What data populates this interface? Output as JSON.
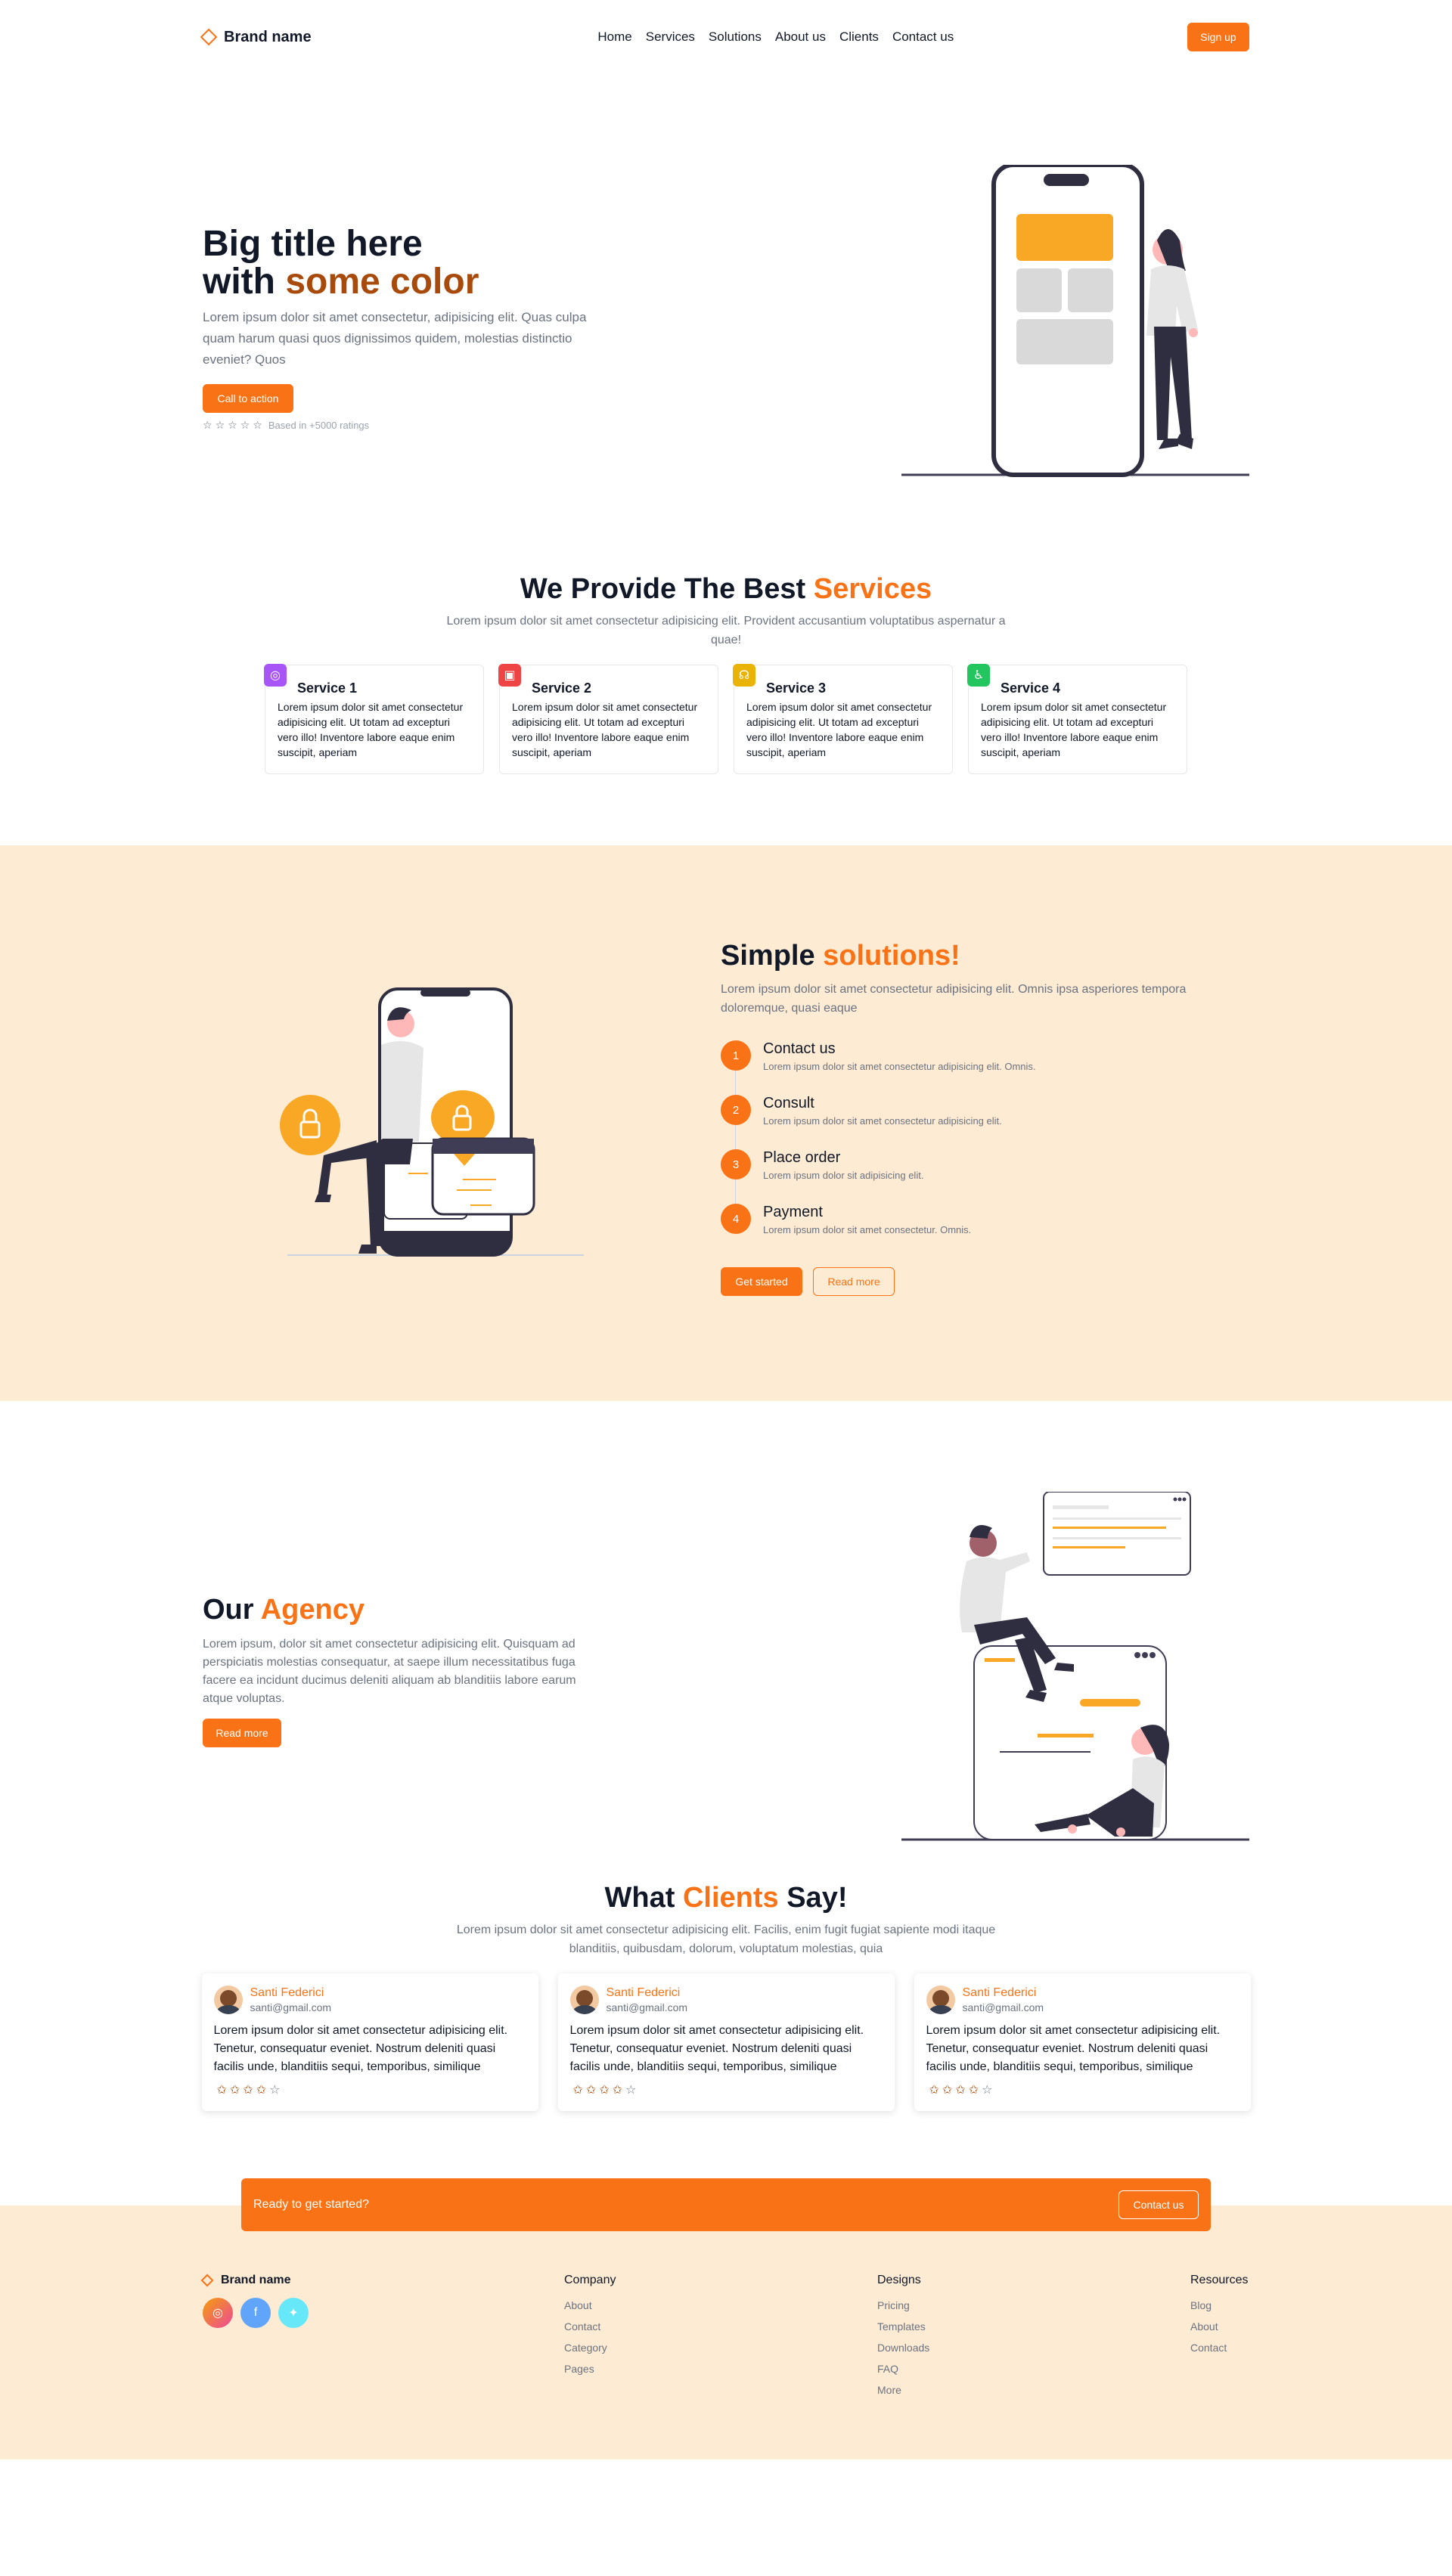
{
  "nav": {
    "brand": "Brand name",
    "links": [
      "Home",
      "Services",
      "Solutions",
      "About us",
      "Clients",
      "Contact us"
    ],
    "signup": "Sign up"
  },
  "hero": {
    "title_line1": "Big title here",
    "title_line2_prefix": "with ",
    "title_line2_accent": "some color",
    "text": "Lorem ipsum dolor sit amet consectetur, adipisicing elit. Quas culpa quam harum quasi quos dignissimos quidem, molestias distinctio eveniet? Quos",
    "cta": "Call to action",
    "rating_text": "Based in +5000 ratings"
  },
  "services": {
    "title_prefix": "We Provide The Best ",
    "title_accent": "Services",
    "subtitle": "Lorem ipsum dolor sit amet consectetur adipisicing elit. Provident accusantium voluptatibus aspernatur a quae!",
    "items": [
      {
        "title": "Service 1",
        "text": "Lorem ipsum dolor sit amet consectetur adipisicing elit. Ut totam ad excepturi vero illo! Inventore labore eaque enim suscipit, aperiam",
        "color": "#a855f7",
        "icon": "dribbble-icon"
      },
      {
        "title": "Service 2",
        "text": "Lorem ipsum dolor sit amet consectetur adipisicing elit. Ut totam ad excepturi vero illo! Inventore labore eaque enim suscipit, aperiam",
        "color": "#ef4444",
        "icon": "document-icon"
      },
      {
        "title": "Service 3",
        "text": "Lorem ipsum dolor sit amet consectetur adipisicing elit. Ut totam ad excepturi vero illo! Inventore labore eaque enim suscipit, aperiam",
        "color": "#eab308",
        "icon": "headset-icon"
      },
      {
        "title": "Service 4",
        "text": "Lorem ipsum dolor sit amet consectetur adipisicing elit. Ut totam ad excepturi vero illo! Inventore labore eaque enim suscipit, aperiam",
        "color": "#22c55e",
        "icon": "accessibility-icon"
      }
    ]
  },
  "solutions": {
    "title_prefix": "Simple ",
    "title_accent": "solutions!",
    "text": "Lorem ipsum dolor sit amet consectetur adipisicing elit. Omnis ipsa asperiores tempora doloremque, quasi eaque",
    "steps": [
      {
        "num": "1",
        "title": "Contact us",
        "text": "Lorem ipsum dolor sit amet consectetur adipisicing elit. Omnis."
      },
      {
        "num": "2",
        "title": "Consult",
        "text": "Lorem ipsum dolor sit amet consectetur adipisicing elit."
      },
      {
        "num": "3",
        "title": "Place order",
        "text": "Lorem ipsum dolor sit adipisicing elit."
      },
      {
        "num": "4",
        "title": "Payment",
        "text": "Lorem ipsum dolor sit amet consectetur. Omnis."
      }
    ],
    "primary_btn": "Get started",
    "secondary_btn": "Read more"
  },
  "agency": {
    "title_prefix": "Our ",
    "title_accent": "Agency",
    "text": "Lorem ipsum, dolor sit amet consectetur adipisicing elit. Quisquam ad perspiciatis molestias consequatur, at saepe illum necessitatibus fuga facere ea incidunt ducimus deleniti aliquam ab blanditiis labore earum atque voluptas.",
    "btn": "Read more"
  },
  "clients": {
    "title_prefix": "What ",
    "title_accent": "Clients",
    "title_suffix": " Say!",
    "subtitle": "Lorem ipsum dolor sit amet consectetur adipisicing elit. Facilis, enim fugit fugiat sapiente modi itaque blanditiis, quibusdam, dolorum, voluptatum molestias, quia",
    "items": [
      {
        "name": "Santi Federici",
        "email": "santi@gmail.com",
        "text": "Lorem ipsum dolor sit amet consectetur adipisicing elit. Tenetur, consequatur eveniet. Nostrum deleniti quasi facilis unde, blanditiis sequi, temporibus, similique",
        "rating": 4
      },
      {
        "name": "Santi Federici",
        "email": "santi@gmail.com",
        "text": "Lorem ipsum dolor sit amet consectetur adipisicing elit. Tenetur, consequatur eveniet. Nostrum deleniti quasi facilis unde, blanditiis sequi, temporibus, similique",
        "rating": 4
      },
      {
        "name": "Santi Federici",
        "email": "santi@gmail.com",
        "text": "Lorem ipsum dolor sit amet consectetur adipisicing elit. Tenetur, consequatur eveniet. Nostrum deleniti quasi facilis unde, blanditiis sequi, temporibus, similique",
        "rating": 4
      }
    ]
  },
  "cta": {
    "text": "Ready to get started?",
    "btn": "Contact us"
  },
  "footer": {
    "brand": "Brand name",
    "socials": [
      {
        "icon": "instagram-icon",
        "color": "#f472b6"
      },
      {
        "icon": "facebook-icon",
        "color": "#60a5fa"
      },
      {
        "icon": "twitter-icon",
        "color": "#67e8f9"
      }
    ],
    "columns": [
      {
        "title": "Company",
        "links": [
          "About",
          "Contact",
          "Category",
          "Pages"
        ]
      },
      {
        "title": "Designs",
        "links": [
          "Pricing",
          "Templates",
          "Downloads",
          "FAQ",
          "More"
        ]
      },
      {
        "title": "Resources",
        "links": [
          "Blog",
          "About",
          "Contact"
        ]
      }
    ]
  },
  "colors": {
    "accent": "#f97316",
    "accent_dark": "#a74a0b",
    "tint_bg": "#fdebd3"
  }
}
